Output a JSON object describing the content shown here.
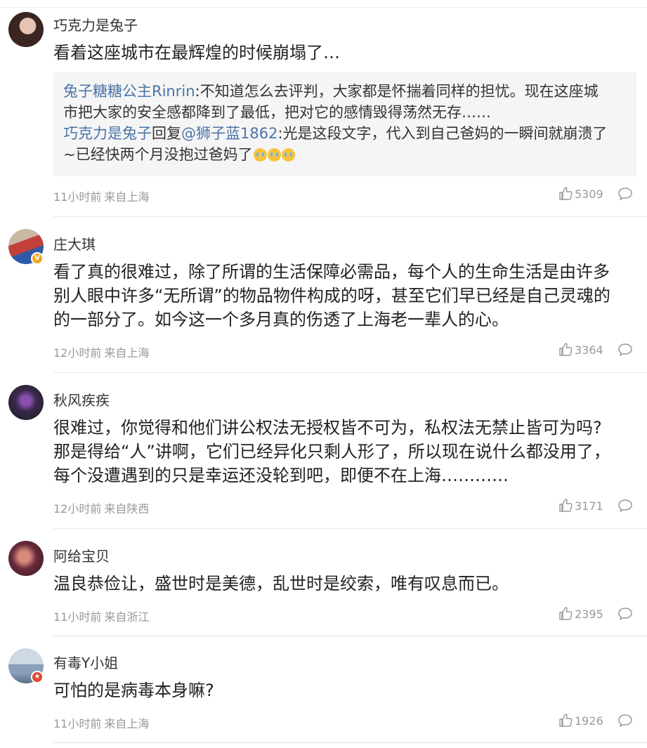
{
  "comments": [
    {
      "username": "巧克力是兔子",
      "text": [
        "看着这座城市在最辉煌的时候崩塌了…"
      ],
      "quote": {
        "line1_mention": "兔子糖糖公主Rinrin",
        "line1_text": ":不知道怎么去评判，大家都是怀揣着同样的担忧。现在这座城",
        "line2_text": "市把大家的安全感都降到了最低，把对它的感情毁得荡然无存……",
        "line3_mention1": "巧克力是兔子",
        "line3_reply": "回复",
        "line3_mention2": "@狮子蓝1862",
        "line3_text": ":光是这段文字，代入到自己爸妈的一瞬间就崩溃了",
        "line4_text": "~已经快两个月没抱过爸妈了",
        "emoji": "crying-emoji"
      },
      "time": "11小时前",
      "location": "来自上海",
      "likes": "5309"
    },
    {
      "username": "庄大琪",
      "verified": true,
      "text": [
        "看了真的很难过，除了所谓的生活保障必需品，每个人的生命生活是由许多",
        "别人眼中许多“无所谓”的物品物件构成的呀，甚至它们早已经是自己灵魂的",
        "的一部分了。如今这一个多月真的伤透了上海老一辈人的心。"
      ],
      "time": "12小时前",
      "location": "来自上海",
      "likes": "3364"
    },
    {
      "username": "秋风疾疾",
      "text": [
        "很难过，你觉得和他们讲公权法无授权皆不可为，私权法无禁止皆可为吗?",
        "那是得给“人”讲啊，它们已经异化只剩人形了，所以现在说什么都没用了，",
        "每个没遭遇到的只是幸运还没轮到吧，即便不在上海…………"
      ],
      "time": "12小时前",
      "location": "来自陕西",
      "likes": "3171"
    },
    {
      "username": "阿给宝贝",
      "text": [
        "温良恭俭让，盛世时是美德，乱世时是绞索，唯有叹息而已。"
      ],
      "time": "11小时前",
      "location": "来自浙江",
      "likes": "2395"
    },
    {
      "username": "有毒Y小姐",
      "badge": true,
      "text": [
        "可怕的是病毒本身嘛?"
      ],
      "time": "11小时前",
      "location": "来自上海",
      "likes": "1926"
    }
  ],
  "colors": {
    "link": "#4a74a8",
    "meta": "#999999",
    "quote_bg": "#f5f5f5",
    "verified": "#f5a623",
    "badge": "#e0452f"
  },
  "icons": {
    "like": "thumbs-up-icon",
    "reply": "comment-bubble-icon"
  }
}
